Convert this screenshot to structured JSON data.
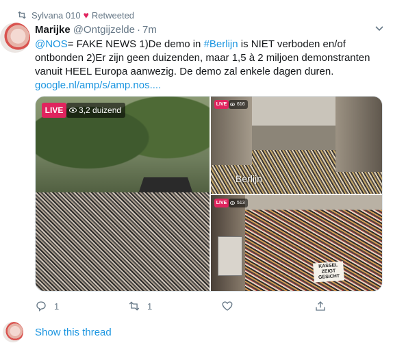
{
  "retweet": {
    "user": "Sylvana 010",
    "label": "Retweeted"
  },
  "tweet": {
    "name": "Marijke",
    "handle": "@Ontgijzelde",
    "time": "7m",
    "mention": "@NOS",
    "text_1": "= FAKE NEWS  1)De demo in ",
    "hashtag": "#Berlijn",
    "text_2": " is NIET verboden en/of ontbonden 2)Er zijn geen duizenden, maar 1,5 à 2 miljoen demonstranten vanuit HEEL Europa aanwezig. De demo zal enkele dagen duren.",
    "link": "google.nl/amp/s/amp.nos...."
  },
  "media": {
    "live_label": "LIVE",
    "main_viewers": "3,2 duizend",
    "top_right_viewers": "616",
    "bottom_right_viewers": "513",
    "city_label": "Berlijn",
    "sign_text": "KASSEL ZEIGT GESICHT"
  },
  "actions": {
    "reply_count": "1",
    "retweet_count": "1"
  },
  "thread": {
    "label": "Show this thread"
  },
  "colors": {
    "link": "#1b95e0",
    "muted": "#657786",
    "live": "#e0245e",
    "heart": "#e0245e"
  }
}
